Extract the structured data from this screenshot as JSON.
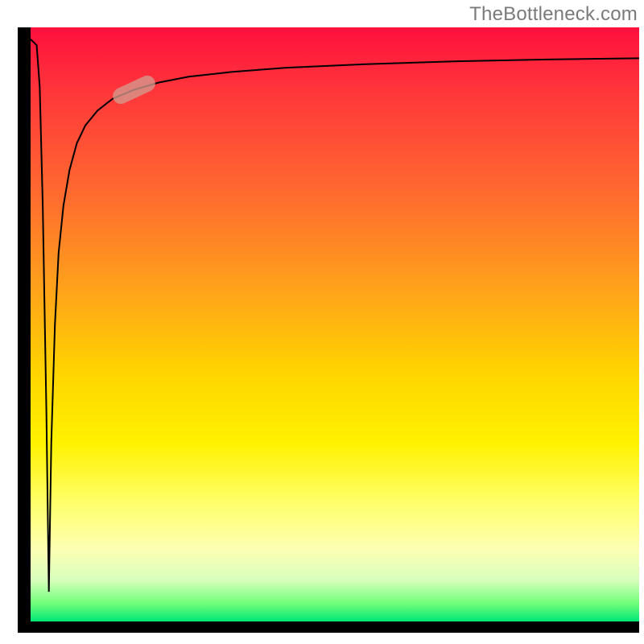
{
  "attribution": "TheBottleneck.com",
  "colors": {
    "axis": "#000000",
    "curve": "#000000",
    "marker": "#d39a8e",
    "gradient_top": "#ff103e",
    "gradient_bottom": "#00e676"
  },
  "chart_data": {
    "type": "line",
    "title": "",
    "xlabel": "",
    "ylabel": "",
    "xlim": [
      0,
      100
    ],
    "ylim": [
      0,
      100
    ],
    "axes_visible": false,
    "grid": false,
    "legend": false,
    "background": "rainbow-vertical (red→orange→yellow→green)",
    "series": [
      {
        "name": "bottleneck-curve",
        "x": [
          0.0,
          1.0,
          1.5,
          2.0,
          2.6,
          3.0,
          3.4,
          4.0,
          4.6,
          5.4,
          6.4,
          7.6,
          9.0,
          11.0,
          13.5,
          17.0,
          21.0,
          26.0,
          33.0,
          42.0,
          55.0,
          70.0,
          85.0,
          100.0
        ],
        "y": [
          98.0,
          97.0,
          90.0,
          70.0,
          35.0,
          5.0,
          30.0,
          50.0,
          62.0,
          70.0,
          76.0,
          80.5,
          83.5,
          86.0,
          88.0,
          89.5,
          90.7,
          91.7,
          92.5,
          93.2,
          93.8,
          94.3,
          94.6,
          94.8
        ]
      }
    ],
    "annotations": [
      {
        "name": "marker-pill",
        "shape": "rounded-rect",
        "center_x": 17.0,
        "center_y": 89.5,
        "angle_deg": -25
      }
    ]
  }
}
